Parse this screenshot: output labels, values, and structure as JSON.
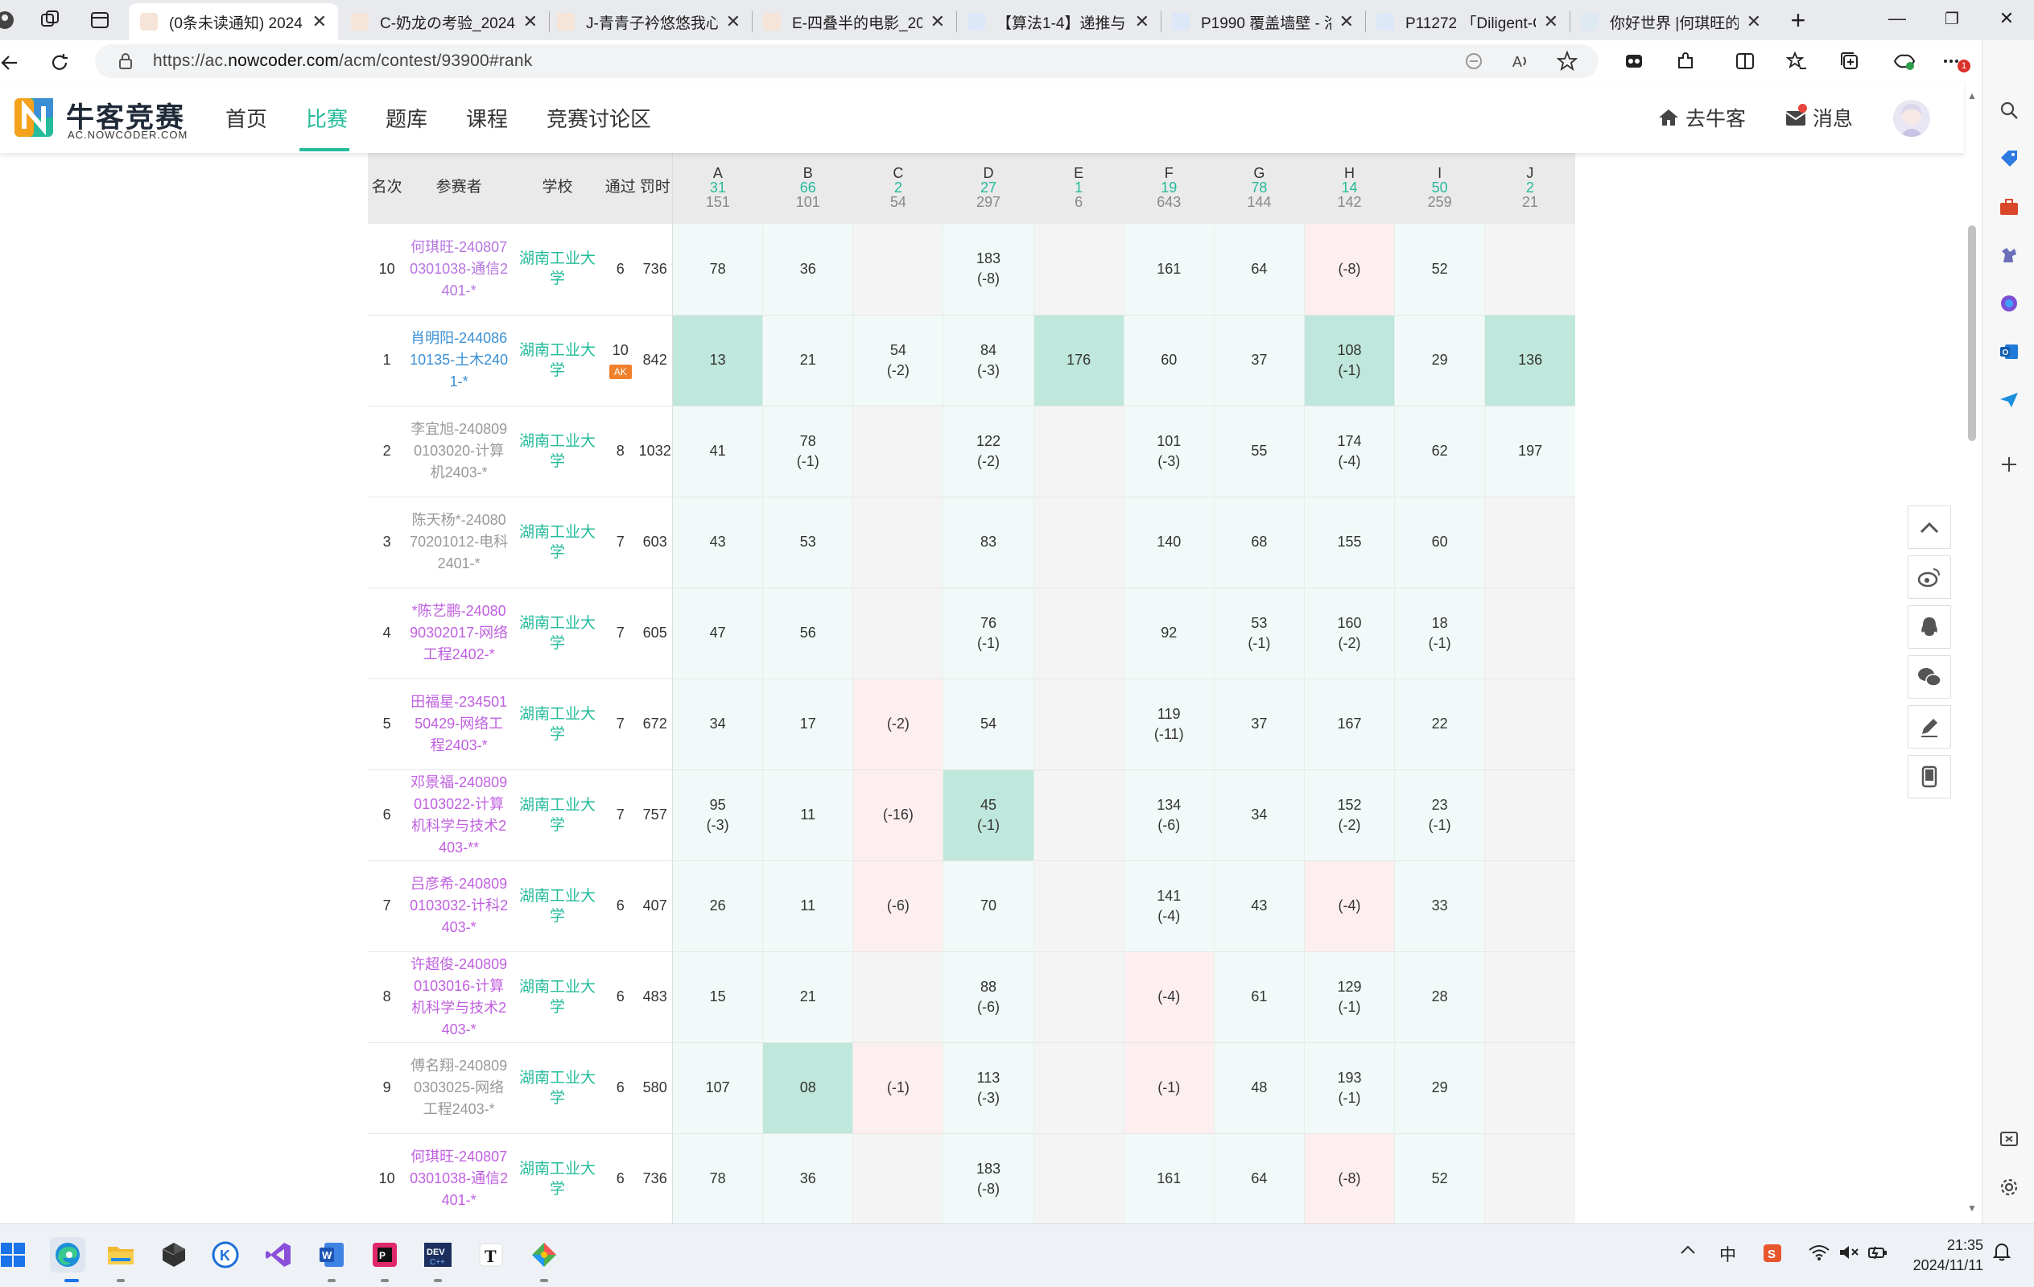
{
  "browser": {
    "tabs": [
      {
        "title": "(0条未读通知) 2024",
        "active": true
      },
      {
        "title": "C-奶龙の考验_2024"
      },
      {
        "title": "J-青青子衿悠悠我心"
      },
      {
        "title": "E-四叠半的电影_202"
      },
      {
        "title": "【算法1-4】递推与"
      },
      {
        "title": "P1990 覆盖墙壁 - 洛"
      },
      {
        "title": "P11272 「Diligent-C"
      },
      {
        "title": "你好世界 |何琪旺的"
      }
    ],
    "url_prefix": "https://ac.",
    "url_domain": "nowcoder.com",
    "url_path": "/acm/contest/93900#rank",
    "new_tab_symbol": "+",
    "minimize_symbol": "—",
    "restore_symbol": "❐",
    "close_symbol": "✕",
    "notification_count": "1"
  },
  "site": {
    "logo_text": "牛客竞赛",
    "logo_sub": "AC.NOWCODER.COM",
    "nav": [
      "首页",
      "比赛",
      "题库",
      "课程",
      "竞赛讨论区"
    ],
    "active_nav_index": 1,
    "go_home": "去牛客",
    "messages": "消息"
  },
  "rank_table": {
    "headers": {
      "rank": "名次",
      "participant": "参赛者",
      "school": "学校",
      "solved": "通过",
      "penalty": "罚时"
    },
    "problems": [
      {
        "letter": "A",
        "ac": "31",
        "total": "151"
      },
      {
        "letter": "B",
        "ac": "66",
        "total": "101"
      },
      {
        "letter": "C",
        "ac": "2",
        "total": "54"
      },
      {
        "letter": "D",
        "ac": "27",
        "total": "297"
      },
      {
        "letter": "E",
        "ac": "1",
        "total": "6"
      },
      {
        "letter": "F",
        "ac": "19",
        "total": "643"
      },
      {
        "letter": "G",
        "ac": "78",
        "total": "144"
      },
      {
        "letter": "H",
        "ac": "14",
        "total": "142"
      },
      {
        "letter": "I",
        "ac": "50",
        "total": "259"
      },
      {
        "letter": "J",
        "ac": "2",
        "total": "21"
      }
    ],
    "rows": [
      {
        "rank": "10",
        "name": [
          "何琪旺-240807",
          "0301038-通信2",
          "401-*"
        ],
        "color": "violet",
        "school": "湖南工业大学",
        "solved": "6",
        "penalty": "736",
        "cells": [
          [
            "78",
            "",
            "ac"
          ],
          [
            "36",
            "",
            "ac"
          ],
          [
            "",
            "",
            "none"
          ],
          [
            "183",
            "(-8)",
            "ac"
          ],
          [
            "",
            "",
            "none"
          ],
          [
            "161",
            "",
            "ac"
          ],
          [
            "64",
            "",
            "ac"
          ],
          [
            "(-8)",
            "",
            "wrong"
          ],
          [
            "52",
            "",
            "ac"
          ],
          [
            "",
            "",
            "none"
          ]
        ]
      },
      {
        "rank": "1",
        "name": [
          "肖明阳-244086",
          "10135-土木240",
          "1-*"
        ],
        "color": "blue",
        "school": "湖南工业大学",
        "solved": "10",
        "badge": "AK",
        "penalty": "842",
        "cells": [
          [
            "13",
            "",
            "first"
          ],
          [
            "21",
            "",
            "ac"
          ],
          [
            "54",
            "(-2)",
            "ac"
          ],
          [
            "84",
            "(-3)",
            "ac"
          ],
          [
            "176",
            "",
            "first"
          ],
          [
            "60",
            "",
            "ac"
          ],
          [
            "37",
            "",
            "ac"
          ],
          [
            "108",
            "(-1)",
            "first"
          ],
          [
            "29",
            "",
            "ac"
          ],
          [
            "136",
            "",
            "first"
          ]
        ]
      },
      {
        "rank": "2",
        "name": [
          "李宜旭-240809",
          "0103020-计算",
          "机2403-*"
        ],
        "color": "gray",
        "school": "湖南工业大学",
        "solved": "8",
        "penalty": "1032",
        "cells": [
          [
            "41",
            "",
            "ac"
          ],
          [
            "78",
            "(-1)",
            "ac"
          ],
          [
            "",
            "",
            "none"
          ],
          [
            "122",
            "(-2)",
            "ac"
          ],
          [
            "",
            "",
            "none"
          ],
          [
            "101",
            "(-3)",
            "ac"
          ],
          [
            "55",
            "",
            "ac"
          ],
          [
            "174",
            "(-4)",
            "ac"
          ],
          [
            "62",
            "",
            "ac"
          ],
          [
            "197",
            "",
            "ac"
          ]
        ]
      },
      {
        "rank": "3",
        "name": [
          "陈天杨*-24080",
          "70201012-电科",
          "2401-*"
        ],
        "color": "gray",
        "school": "湖南工业大学",
        "solved": "7",
        "penalty": "603",
        "cells": [
          [
            "43",
            "",
            "ac"
          ],
          [
            "53",
            "",
            "ac"
          ],
          [
            "",
            "",
            "none"
          ],
          [
            "83",
            "",
            "ac"
          ],
          [
            "",
            "",
            "none"
          ],
          [
            "140",
            "",
            "ac"
          ],
          [
            "68",
            "",
            "ac"
          ],
          [
            "155",
            "",
            "ac"
          ],
          [
            "60",
            "",
            "ac"
          ],
          [
            "",
            "",
            "none"
          ]
        ]
      },
      {
        "rank": "4",
        "name": [
          "*陈艺鹏-24080",
          "90302017-网络",
          "工程2402-*"
        ],
        "color": "purple",
        "school": "湖南工业大学",
        "solved": "7",
        "penalty": "605",
        "cells": [
          [
            "47",
            "",
            "ac"
          ],
          [
            "56",
            "",
            "ac"
          ],
          [
            "",
            "",
            "none"
          ],
          [
            "76",
            "(-1)",
            "ac"
          ],
          [
            "",
            "",
            "none"
          ],
          [
            "92",
            "",
            "ac"
          ],
          [
            "53",
            "(-1)",
            "ac"
          ],
          [
            "160",
            "(-2)",
            "ac"
          ],
          [
            "18",
            "(-1)",
            "ac"
          ],
          [
            "",
            "",
            "none"
          ]
        ]
      },
      {
        "rank": "5",
        "name": [
          "田福星-234501",
          "50429-网络工",
          "程2403-*"
        ],
        "color": "purple",
        "school": "湖南工业大学",
        "solved": "7",
        "penalty": "672",
        "cells": [
          [
            "34",
            "",
            "ac"
          ],
          [
            "17",
            "",
            "ac"
          ],
          [
            "(-2)",
            "",
            "wrong"
          ],
          [
            "54",
            "",
            "ac"
          ],
          [
            "",
            "",
            "none"
          ],
          [
            "119",
            "(-11)",
            "ac"
          ],
          [
            "37",
            "",
            "ac"
          ],
          [
            "167",
            "",
            "ac"
          ],
          [
            "22",
            "",
            "ac"
          ],
          [
            "",
            "",
            "none"
          ]
        ]
      },
      {
        "rank": "6",
        "name": [
          "邓景福-240809",
          "0103022-计算",
          "机科学与技术2",
          "403-**"
        ],
        "color": "purple",
        "school": "湖南工业大学",
        "solved": "7",
        "penalty": "757",
        "cells": [
          [
            "95",
            "(-3)",
            "ac"
          ],
          [
            "11",
            "",
            "ac"
          ],
          [
            "(-16)",
            "",
            "wrong"
          ],
          [
            "45",
            "(-1)",
            "first"
          ],
          [
            "",
            "",
            "none"
          ],
          [
            "134",
            "(-6)",
            "ac"
          ],
          [
            "34",
            "",
            "ac"
          ],
          [
            "152",
            "(-2)",
            "ac"
          ],
          [
            "23",
            "(-1)",
            "ac"
          ],
          [
            "",
            "",
            "none"
          ]
        ]
      },
      {
        "rank": "7",
        "name": [
          "吕彦希-240809",
          "0103032-计科2",
          "403-*"
        ],
        "color": "purple",
        "school": "湖南工业大学",
        "solved": "6",
        "penalty": "407",
        "cells": [
          [
            "26",
            "",
            "ac"
          ],
          [
            "11",
            "",
            "ac"
          ],
          [
            "(-6)",
            "",
            "wrong"
          ],
          [
            "70",
            "",
            "ac"
          ],
          [
            "",
            "",
            "none"
          ],
          [
            "141",
            "(-4)",
            "ac"
          ],
          [
            "43",
            "",
            "ac"
          ],
          [
            "(-4)",
            "",
            "wrong"
          ],
          [
            "33",
            "",
            "ac"
          ],
          [
            "",
            "",
            "none"
          ]
        ]
      },
      {
        "rank": "8",
        "name": [
          "许超俊-240809",
          "0103016-计算",
          "机科学与技术2",
          "403-*"
        ],
        "color": "purple",
        "school": "湖南工业大学",
        "solved": "6",
        "penalty": "483",
        "cells": [
          [
            "15",
            "",
            "ac"
          ],
          [
            "21",
            "",
            "ac"
          ],
          [
            "",
            "",
            "none"
          ],
          [
            "88",
            "(-6)",
            "ac"
          ],
          [
            "",
            "",
            "none"
          ],
          [
            "(-4)",
            "",
            "wrong"
          ],
          [
            "61",
            "",
            "ac"
          ],
          [
            "129",
            "(-1)",
            "ac"
          ],
          [
            "28",
            "",
            "ac"
          ],
          [
            "",
            "",
            "none"
          ]
        ]
      },
      {
        "rank": "9",
        "name": [
          "傅名翔-240809",
          "0303025-网络",
          "工程2403-*"
        ],
        "color": "gray",
        "school": "湖南工业大学",
        "solved": "6",
        "penalty": "580",
        "cells": [
          [
            "107",
            "",
            "ac"
          ],
          [
            "08",
            "",
            "first"
          ],
          [
            "(-1)",
            "",
            "wrong"
          ],
          [
            "113",
            "(-3)",
            "ac"
          ],
          [
            "",
            "",
            "none"
          ],
          [
            "(-1)",
            "",
            "wrong"
          ],
          [
            "48",
            "",
            "ac"
          ],
          [
            "193",
            "(-1)",
            "ac"
          ],
          [
            "29",
            "",
            "ac"
          ],
          [
            "",
            "",
            "none"
          ]
        ]
      },
      {
        "rank": "10",
        "name": [
          "何琪旺-240807",
          "0301038-通信2",
          "401-*"
        ],
        "color": "purple",
        "school": "湖南工业大学",
        "solved": "6",
        "penalty": "736",
        "cells": [
          [
            "78",
            "",
            "ac"
          ],
          [
            "36",
            "",
            "ac"
          ],
          [
            "",
            "",
            "none"
          ],
          [
            "183",
            "(-8)",
            "ac"
          ],
          [
            "",
            "",
            "none"
          ],
          [
            "161",
            "",
            "ac"
          ],
          [
            "64",
            "",
            "ac"
          ],
          [
            "(-8)",
            "",
            "wrong"
          ],
          [
            "52",
            "",
            "ac"
          ],
          [
            "",
            "",
            "none"
          ]
        ]
      }
    ]
  },
  "taskbar": {
    "time": "21:35",
    "date": "2024/11/11",
    "ime": "中"
  },
  "colors": {
    "accent": "#25bb9b",
    "first_blood": "#bfe7dc",
    "accepted": "#f1faf8",
    "wrong": "#fdeef0",
    "ak_badge": "#f0802b"
  }
}
